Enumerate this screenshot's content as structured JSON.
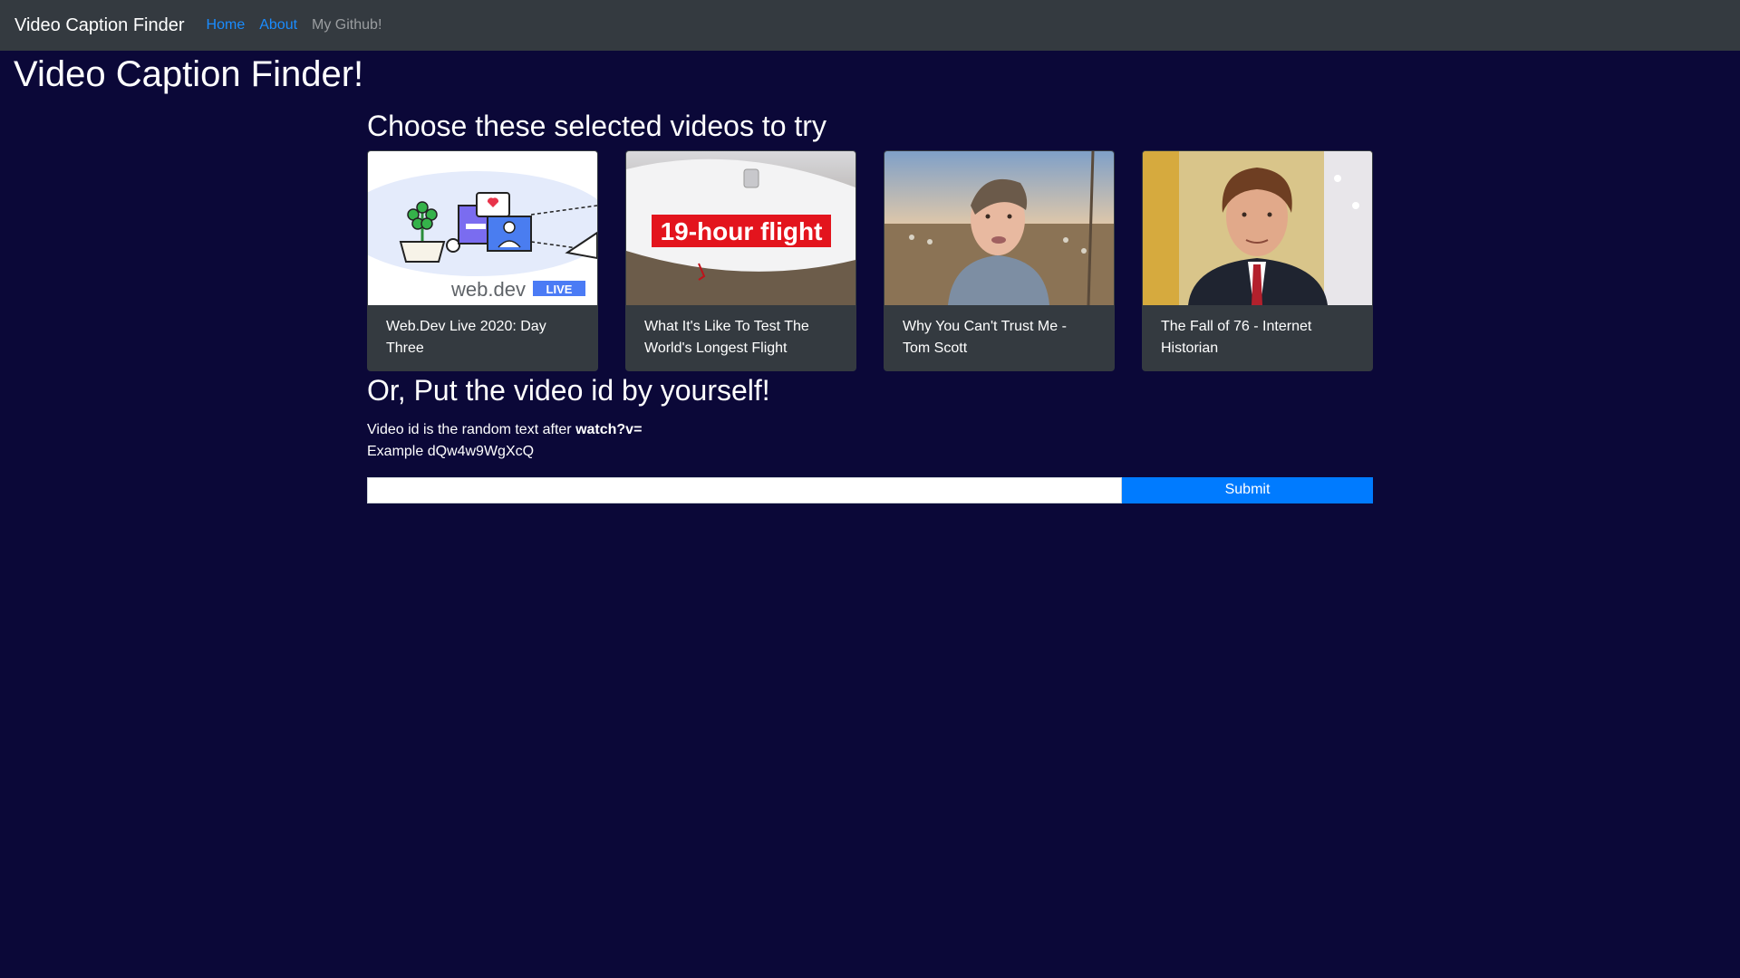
{
  "navbar": {
    "brand": "Video Caption Finder",
    "links": [
      {
        "label": "Home"
      },
      {
        "label": "About"
      },
      {
        "label": "My Github!"
      }
    ]
  },
  "page_title": "Video Caption Finder!",
  "selected": {
    "heading": "Choose these selected videos to try",
    "videos": [
      {
        "title": "Web.Dev Live 2020: Day Three",
        "thumb_text": "web.dev",
        "thumb_badge": "LIVE"
      },
      {
        "title": "What It's Like To Test The World's Longest Flight",
        "thumb_text": "19-hour flight"
      },
      {
        "title": "Why You Can't Trust Me - Tom Scott"
      },
      {
        "title": "The Fall of 76 - Internet Historian"
      }
    ]
  },
  "manual": {
    "heading": "Or, Put the video id by yourself!",
    "hint_prefix": "Video id is the random text after ",
    "hint_bold": "watch?v=",
    "example": "Example dQw4w9WgXcQ",
    "input_value": "",
    "submit_label": "Submit"
  },
  "colors": {
    "background": "#0b0838",
    "navbar": "#343a40",
    "link_active": "#1a8cff",
    "submit": "#007bff"
  }
}
